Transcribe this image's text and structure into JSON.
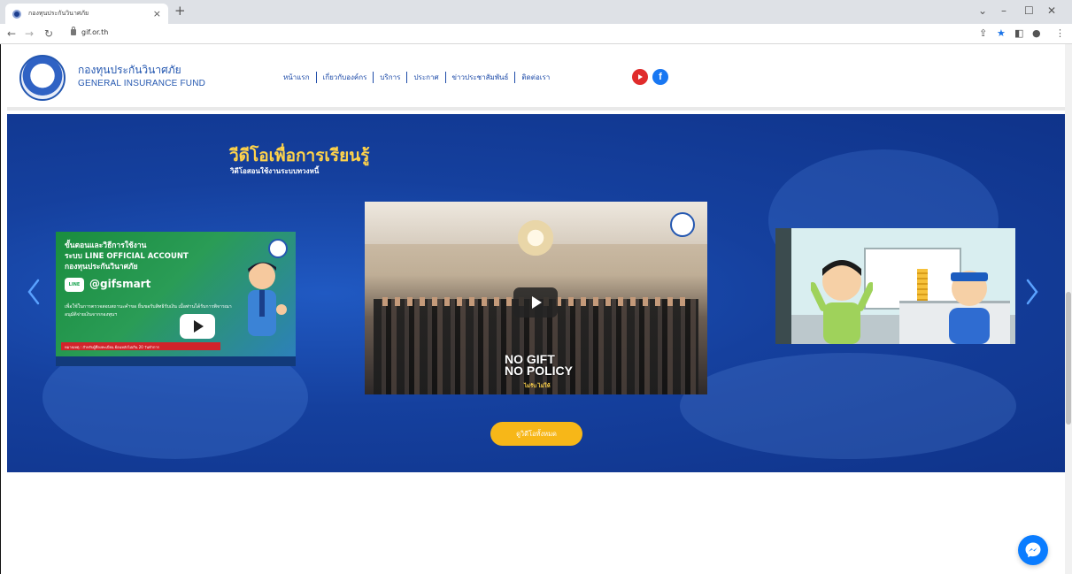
{
  "browser": {
    "tab_title": "กองทุนประกันวินาศภัย",
    "tab_close": "×",
    "new_tab": "+",
    "url": "gif.or.th",
    "window_controls": [
      "⌄",
      "–",
      "☐",
      "✕"
    ]
  },
  "header": {
    "brand_th": "กองทุนประกันวินาศภัย",
    "brand_en": "GENERAL INSURANCE FUND",
    "nav": [
      "หน้าแรก",
      "เกี่ยวกับองค์กร",
      "บริการ",
      "ประกาศ",
      "ข่าวประชาสัมพันธ์",
      "ติดต่อเรา"
    ],
    "social": {
      "youtube_color": "#e02b2b",
      "facebook_color": "#1877f2",
      "facebook_label": "f"
    }
  },
  "video_section": {
    "title": "วีดีโอเพื่อการเรียนรู้",
    "subtitle": "วิดีโอสอนใช้งานระบบทวงหนี้",
    "thumb1": {
      "line1": "ขั้นตอนและวิธีการใช้งาน",
      "line2": "ระบบ LINE OFFICIAL ACCOUNT",
      "line3": "กองทุนประกันวินาศภัย",
      "line_badge": "LINE",
      "handle": "@gifsmart",
      "desc": "เพื่อใช้ในการตรวจสอบสถานะคำขอ ยื่นขอรับสิทธิรับเงิน เมื่อท่านได้รับการพิจารณาอนุมัติจ่ายเงินจากกองทุนฯ",
      "band": "หมายเหตุ : สำหรับผู้ที่ลงทะเบียน ย้อนหลังไม่เกิน 20 วันทำการ"
    },
    "thumb2": {
      "nogift_line1": "NO GIFT",
      "nogift_line2": "NO POLICY",
      "nogift_sub": "ไม่รับ ไม่ให้"
    },
    "button_label": "ดูวิดีโอทั้งหมด",
    "accent": "#f7b718"
  }
}
